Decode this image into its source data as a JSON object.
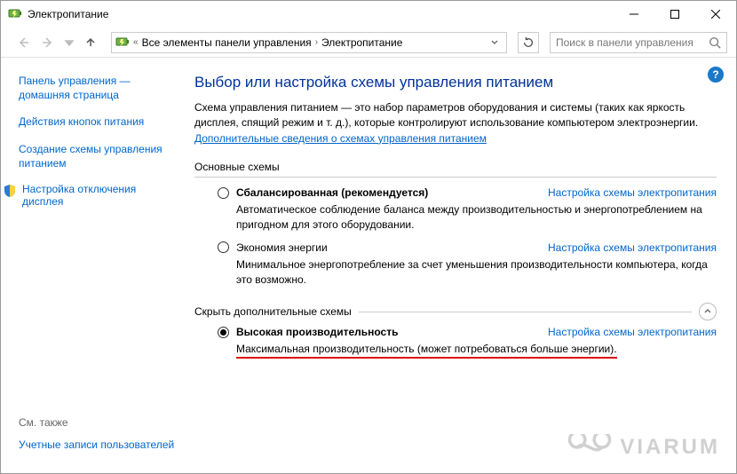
{
  "window": {
    "title": "Электропитание"
  },
  "breadcrumb": {
    "item1": "Все элементы панели управления",
    "item2": "Электропитание"
  },
  "search": {
    "placeholder": "Поиск в панели управления"
  },
  "sidebar": {
    "home": "Панель управления — домашняя страница",
    "l1": "Действия кнопок питания",
    "l2": "Создание схемы управления питанием",
    "l3": "Настройка отключения дисплея",
    "see_also_label": "См. также",
    "see_also_1": "Учетные записи пользователей"
  },
  "main": {
    "title": "Выбор или настройка схемы управления питанием",
    "intro1": "Схема управления питанием — это набор параметров оборудования и системы (таких как яркость дисплея, спящий режим и т. д.), которые контролируют использование компьютером электроэнергии. ",
    "intro_link": "Дополнительные сведения о схемах управления питанием",
    "section1": "Основные схемы",
    "section2": "Скрыть дополнительные схемы",
    "plan_settings": "Настройка схемы электропитания",
    "p1_name": "Сбалансированная (рекомендуется)",
    "p1_desc": "Автоматическое соблюдение баланса между производительностью и энергопотреблением на пригодном для этого оборудовании.",
    "p2_name": "Экономия энергии",
    "p2_desc": "Минимальное энергопотребление за счет уменьшения производительности компьютера, когда это возможно.",
    "p3_name": "Высокая производительность",
    "p3_desc": "Максимальная производительность (может потребоваться больше энергии)."
  },
  "watermark": {
    "text": "VIARUM"
  }
}
